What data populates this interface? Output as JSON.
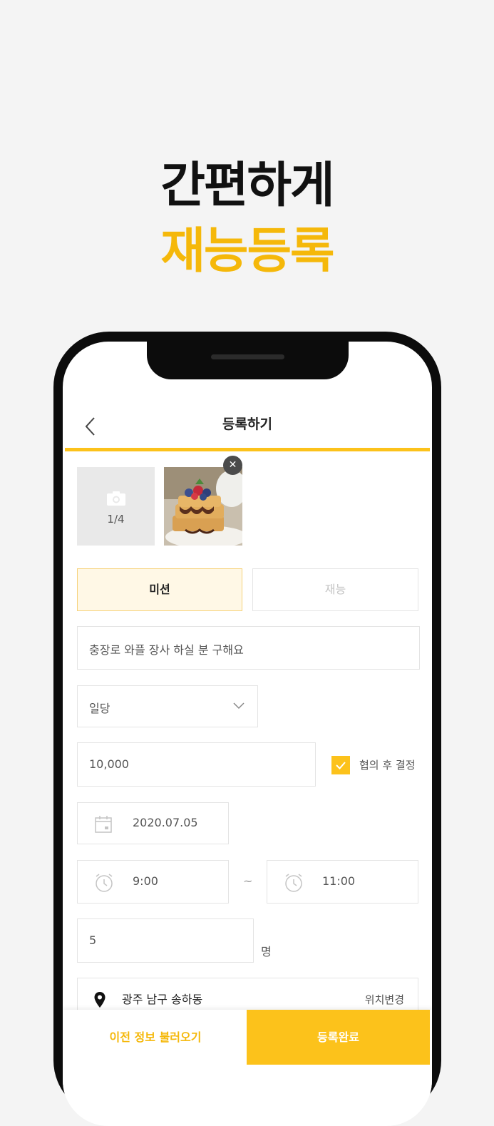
{
  "hero": {
    "line1": "간편하게",
    "line2": "재능등록"
  },
  "header": {
    "title": "등록하기"
  },
  "colors": {
    "accent": "#fcc21b",
    "accent_text": "#f5b80a",
    "tab_selected_bg": "#fff8e6"
  },
  "photos": {
    "count": "1/4",
    "thumb_alt": "waffle-photo"
  },
  "type_tabs": [
    {
      "label": "미션",
      "selected": true
    },
    {
      "label": "재능",
      "selected": false
    }
  ],
  "form": {
    "title": "충장로 와플 장사 하실 분 구해요",
    "pay_type": "일당",
    "price": "10,000",
    "negotiable_label": "협의 후 결정",
    "negotiable_checked": true,
    "date": "2020.07.05",
    "time_start": "9:00",
    "time_separator": "~",
    "time_end": "11:00",
    "headcount": "5",
    "headcount_unit": "명",
    "location": "광주 남구 송하동",
    "location_change": "위치변경"
  },
  "bottom": {
    "prev_info": "이전 정보 불러오기",
    "submit": "등록완료"
  },
  "icons": [
    "back-arrow-icon",
    "camera-icon",
    "close-icon",
    "chevron-down-icon",
    "check-icon",
    "calendar-icon",
    "alarm-clock-icon",
    "location-pin-icon"
  ]
}
